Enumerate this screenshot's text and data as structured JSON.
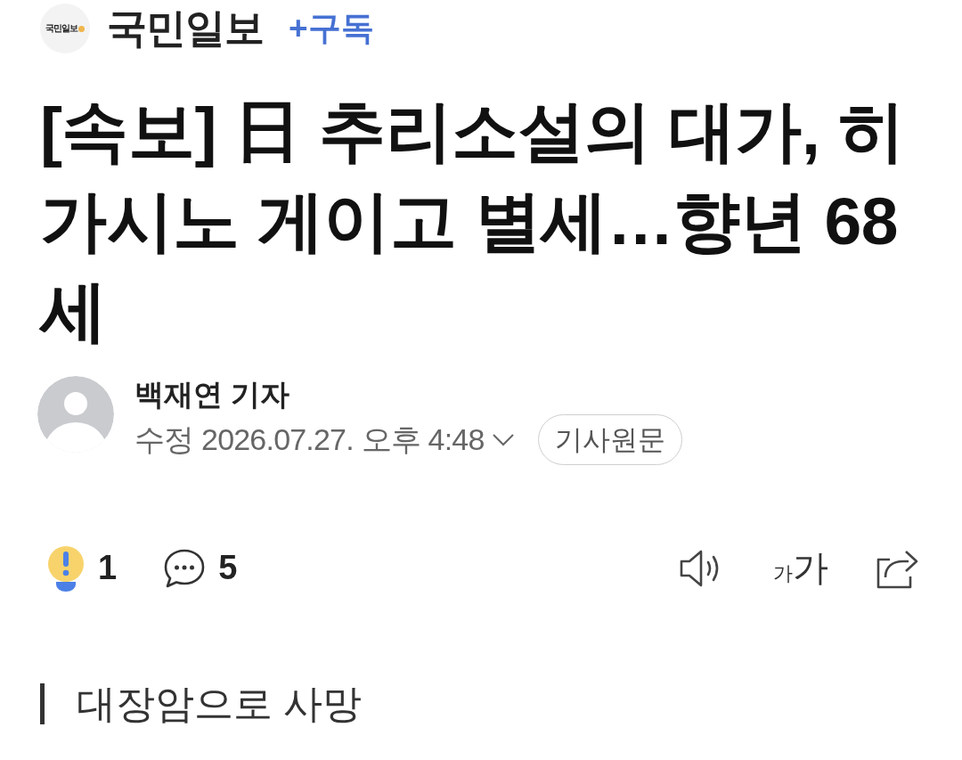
{
  "header": {
    "logo_text": "국민일보",
    "publisher": "국민일보",
    "subscribe_button": "+구독"
  },
  "headline": "[속보] 日 추리소설의 대가, 히가시노 게이고 별세…향년 68세",
  "byline": {
    "reporter": "백재연 기자",
    "timestamp": "수정 2026.07.27. 오후 4:48",
    "expanded": false,
    "original_article_button": "기사원문"
  },
  "actions": {
    "reaction_count": "1",
    "comment_count": "5",
    "font_size_button": {
      "small": "가",
      "large": "가"
    }
  },
  "subheading": "대장암으로 사망"
}
